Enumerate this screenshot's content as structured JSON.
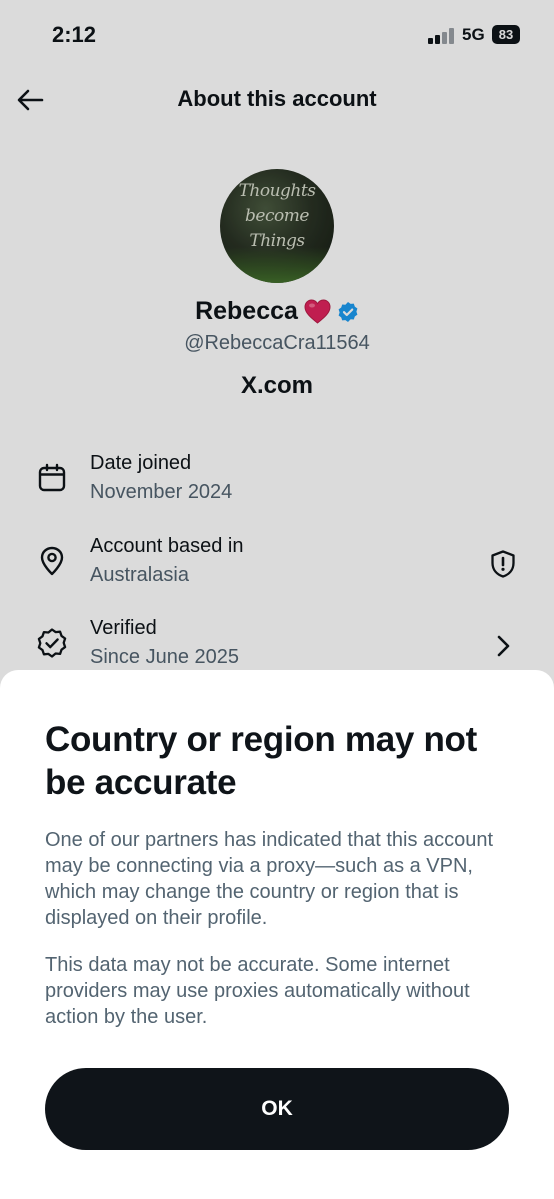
{
  "status_bar": {
    "time": "2:12",
    "network": "5G",
    "battery": "83"
  },
  "header": {
    "title": "About this account"
  },
  "profile": {
    "avatar_text": [
      "Thoughts",
      "become",
      "Things"
    ],
    "display_name": "Rebecca",
    "handle": "@RebeccaCra11564",
    "source": "X.com"
  },
  "info": [
    {
      "label": "Date joined",
      "value": "November 2024",
      "icon": "calendar-icon"
    },
    {
      "label": "Account based in",
      "value": "Australasia",
      "icon": "location-pin-icon",
      "trailing_icon": "shield-alert-icon"
    },
    {
      "label": "Verified",
      "value": "Since June 2025",
      "icon": "verified-badge-icon",
      "trailing_icon": "chevron-right-icon"
    }
  ],
  "sheet": {
    "title": "Country or region may not be accurate",
    "body_1": "One of our partners has indicated that this account may be connecting via a proxy—such as a VPN, which may change the country or region that is displayed on their profile.",
    "body_2": "This data may not be accurate. Some internet providers may use proxies automatically without action by the user.",
    "ok_label": "OK"
  },
  "colors": {
    "text_primary": "#0f1419",
    "text_secondary": "#536471",
    "verified_blue": "#1d9bf0",
    "heart_red": "#e0245e",
    "button_bg": "#0f1419"
  }
}
